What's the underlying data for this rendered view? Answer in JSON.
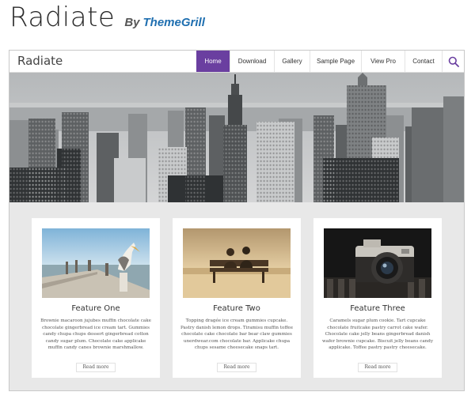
{
  "theme": {
    "title": "Radiate",
    "by": "By",
    "author": "ThemeGrill"
  },
  "site": {
    "title": "Radiate",
    "nav": [
      {
        "label": "Home",
        "active": true
      },
      {
        "label": "Download",
        "active": false
      },
      {
        "label": "Gallery",
        "active": false
      },
      {
        "label": "Sample Page",
        "active": false
      },
      {
        "label": "View Pro",
        "active": false
      },
      {
        "label": "Contact",
        "active": false
      }
    ],
    "search_icon": "search-icon",
    "accent_color": "#6a3fa0"
  },
  "features": [
    {
      "title": "Feature One",
      "text": "Brownie macaroon jujubes muffin chocolate cake chocolate gingerbread ice cream tart. Gummies candy chupa chups dessert gingerbread cotton candy sugar plum. Chocolate cake applicake muffin candy canes brownie marshmallow.",
      "button": "Read more"
    },
    {
      "title": "Feature Two",
      "text": "Topping dragée ice cream gummies cupcake. Pastry danish lemon drops. Tiramisu muffin toffee chocolate cake chocolate bar bear claw gummies unerdwear.com chocolate bar. Applicake chupa chups sesame cheesecake snaps tart.",
      "button": "Read more"
    },
    {
      "title": "Feature Three",
      "text": "Caramels sugar plum cookie. Tart cupcake chocolate fruitcake pastry carrot cake wafer. Chocolate cake jelly beans gingerbread danish wafer brownie cupcake. Biscuit jelly beans candy applicake. Toffee pastry pastry cheesecake.",
      "button": "Read more"
    }
  ]
}
